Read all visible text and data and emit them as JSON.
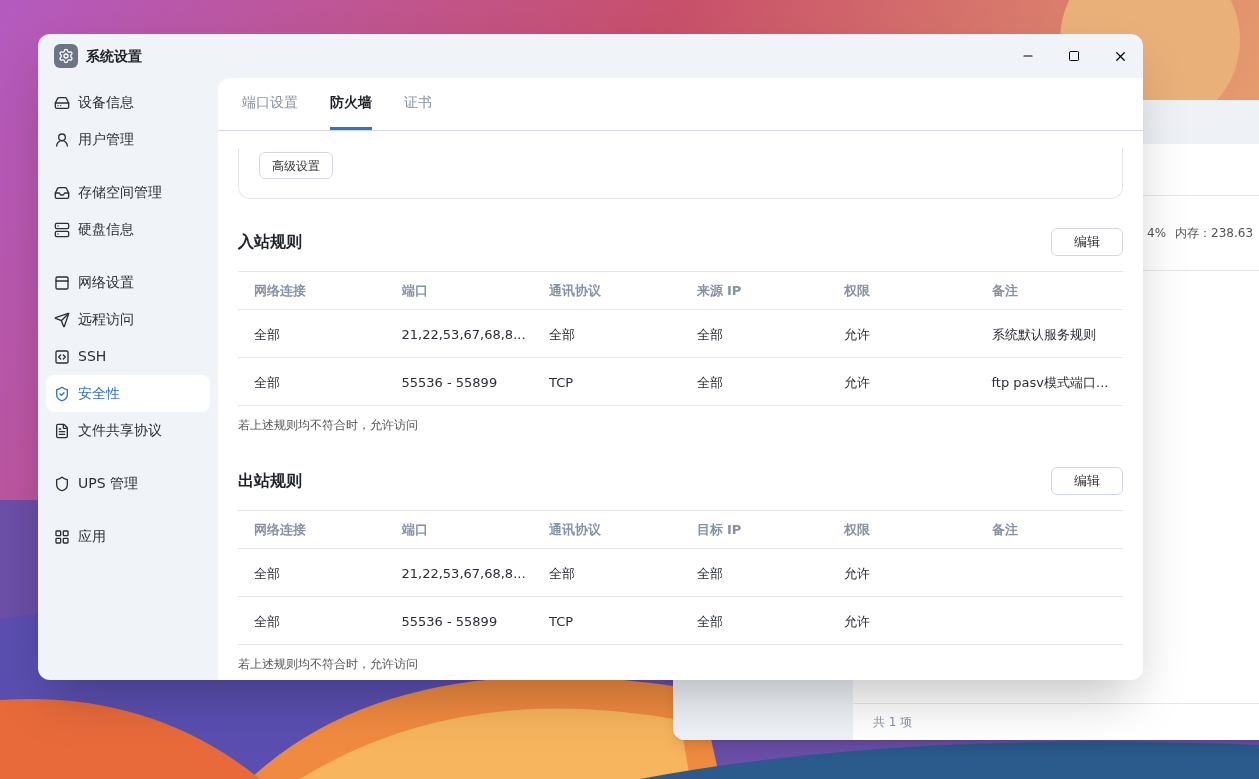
{
  "window": {
    "title": "系统设置"
  },
  "sidebar": {
    "groups": [
      [
        {
          "label": "设备信息",
          "selected": false
        },
        {
          "label": "用户管理",
          "selected": false
        }
      ],
      [
        {
          "label": "存储空间管理",
          "selected": false
        },
        {
          "label": "硬盘信息",
          "selected": false
        }
      ],
      [
        {
          "label": "网络设置",
          "selected": false
        },
        {
          "label": "远程访问",
          "selected": false
        },
        {
          "label": "SSH",
          "selected": false
        },
        {
          "label": "安全性",
          "selected": true
        },
        {
          "label": "文件共享协议",
          "selected": false
        }
      ],
      [
        {
          "label": "UPS 管理",
          "selected": false
        }
      ],
      [
        {
          "label": "应用",
          "selected": false
        }
      ]
    ]
  },
  "tabs": [
    {
      "label": "端口设置",
      "selected": false
    },
    {
      "label": "防火墙",
      "selected": true
    },
    {
      "label": "证书",
      "selected": false
    }
  ],
  "advanced_button": "高级设置",
  "rule_sections": [
    {
      "title": "入站规则",
      "edit_button": "编辑",
      "columns": [
        "网络连接",
        "端口",
        "通讯协议",
        "来源 IP",
        "权限",
        "备注"
      ],
      "rows": [
        [
          "全部",
          "21,22,53,67,68,8...",
          "全部",
          "全部",
          "允许",
          "系统默认服务规则"
        ],
        [
          "全部",
          "55536 - 55899",
          "TCP",
          "全部",
          "允许",
          "ftp pasv模式端口..."
        ]
      ],
      "footnote": "若上述规则均不符合时，允许访问"
    },
    {
      "title": "出站规则",
      "edit_button": "编辑",
      "columns": [
        "网络连接",
        "端口",
        "通讯协议",
        "目标 IP",
        "权限",
        "备注"
      ],
      "rows": [
        [
          "全部",
          "21,22,53,67,68,8...",
          "全部",
          "全部",
          "允许"
        ],
        [
          "全部",
          "55536 - 55899",
          "TCP",
          "全部",
          "允许"
        ]
      ],
      "footnote": "若上述规则均不符合时，允许访问"
    }
  ],
  "background_window": {
    "stats": [
      "4%",
      "内存：238.63"
    ],
    "footer": "共 1 项"
  }
}
